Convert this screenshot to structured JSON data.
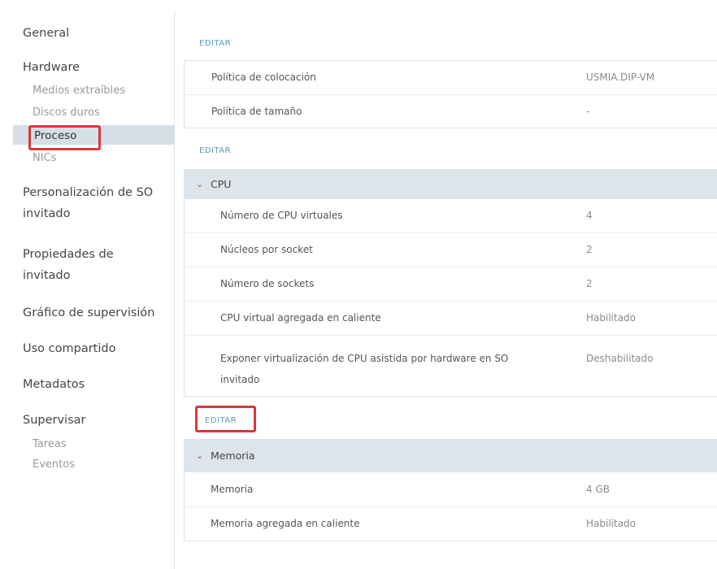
{
  "sidebar": {
    "general": "General",
    "hardware": "Hardware",
    "hardware_items": [
      "Medios extraíbles",
      "Discos duros",
      "Proceso",
      "NICs"
    ],
    "guest_custom_1": "Personalización de SO",
    "guest_custom_2": "invitado",
    "guest_props_1": "Propiedades de",
    "guest_props_2": "invitado",
    "monitor_graph": "Gráfico de supervisión",
    "sharing": "Uso compartido",
    "metadata": "Metadatos",
    "supervise": "Supervisar",
    "supervise_items": [
      "Tareas",
      "Eventos"
    ]
  },
  "edit_label": "EDITAR",
  "policies": {
    "rows": [
      {
        "label": "Política de colocación",
        "value": "USMIA.DIP-VM"
      },
      {
        "label": "Política de tamaño",
        "value": "-"
      }
    ]
  },
  "cpu": {
    "title": "CPU",
    "rows": [
      {
        "label": "Número de CPU virtuales",
        "value": "4"
      },
      {
        "label": "Núcleos por socket",
        "value": "2"
      },
      {
        "label": "Número de sockets",
        "value": "2"
      },
      {
        "label": "CPU virtual agregada en caliente",
        "value": "Habilitado"
      },
      {
        "label": "Exponer virtualización de CPU asistida por hardware en SO",
        "label2": "invitado",
        "value": "Deshabilitado"
      }
    ]
  },
  "memory": {
    "title": "Memoria",
    "rows": [
      {
        "label": "Memoria",
        "value": "4 GB"
      },
      {
        "label": "Memoria agregada en caliente",
        "value": "Habilitado"
      }
    ]
  },
  "colors": {
    "highlight_box": "#d9373c",
    "active_nav": "#d5dfe7",
    "section_header": "#dde4ea",
    "edit_link": "#5b9ab8"
  }
}
